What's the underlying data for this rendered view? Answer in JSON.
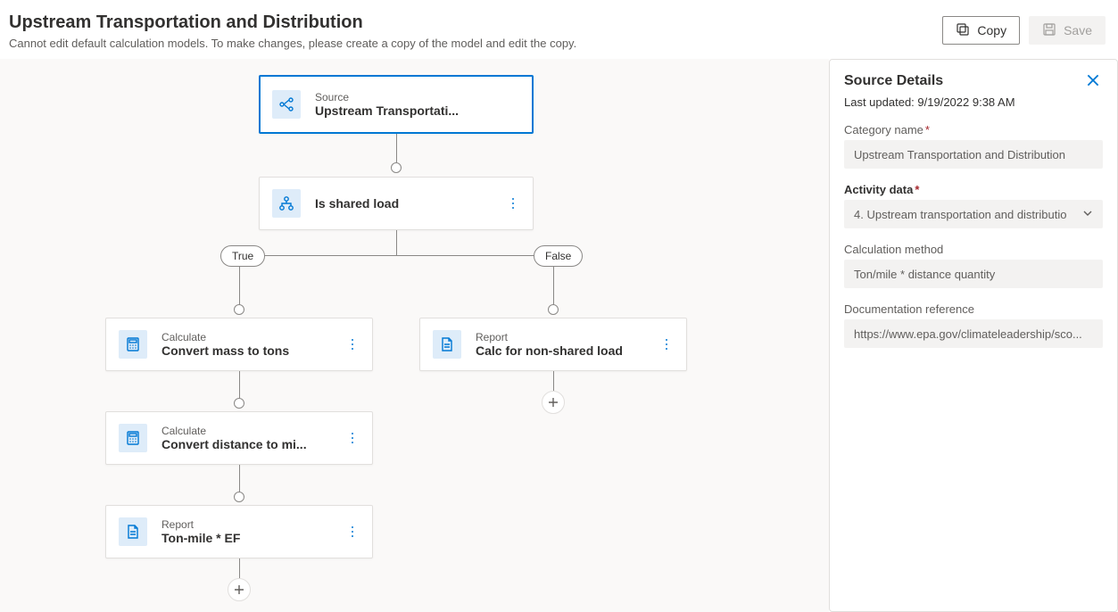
{
  "header": {
    "title": "Upstream Transportation and Distribution",
    "subtitle": "Cannot edit default calculation models. To make changes, please create a copy of the model and edit the copy.",
    "copy_label": "Copy",
    "save_label": "Save"
  },
  "flow": {
    "source": {
      "kind": "Source",
      "label": "Upstream Transportati..."
    },
    "condition": {
      "label": "Is shared load"
    },
    "branch_true": "True",
    "branch_false": "False",
    "true_chain": [
      {
        "kind": "Calculate",
        "label": "Convert mass to tons",
        "icon": "calculator"
      },
      {
        "kind": "Calculate",
        "label": "Convert distance to mi...",
        "icon": "calculator"
      },
      {
        "kind": "Report",
        "label": "Ton-mile * EF",
        "icon": "report"
      }
    ],
    "false_chain": [
      {
        "kind": "Report",
        "label": "Calc for non-shared load",
        "icon": "report"
      }
    ]
  },
  "panel": {
    "title": "Source Details",
    "updated_prefix": "Last updated: ",
    "updated_value": "9/19/2022 9:38 AM",
    "category_label": "Category name",
    "category_value": "Upstream Transportation and Distribution",
    "activity_label": "Activity data",
    "activity_value": "4. Upstream transportation and distributio",
    "calc_label": "Calculation method",
    "calc_value": "Ton/mile * distance quantity",
    "doc_label": "Documentation reference",
    "doc_value": "https://www.epa.gov/climateleadership/sco..."
  }
}
